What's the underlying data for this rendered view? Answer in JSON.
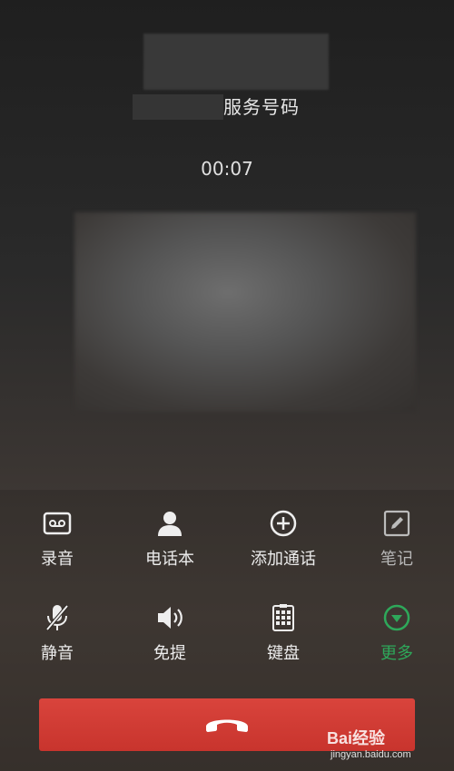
{
  "caller": {
    "number_label": "服务号码",
    "duration": "00:07"
  },
  "controls": [
    {
      "id": "record",
      "label": "录音",
      "icon": "record-icon"
    },
    {
      "id": "contacts",
      "label": "电话本",
      "icon": "contacts-icon"
    },
    {
      "id": "add-call",
      "label": "添加通话",
      "icon": "add-call-icon"
    },
    {
      "id": "notes",
      "label": "笔记",
      "icon": "notes-icon"
    },
    {
      "id": "mute",
      "label": "静音",
      "icon": "mute-icon"
    },
    {
      "id": "speaker",
      "label": "免提",
      "icon": "speaker-icon"
    },
    {
      "id": "keypad",
      "label": "键盘",
      "icon": "keypad-icon"
    },
    {
      "id": "more",
      "label": "更多",
      "icon": "chevron-down-circle-icon"
    }
  ],
  "end_call": {
    "icon": "end-call-icon"
  },
  "watermark": {
    "main": "Bai经验",
    "sub": "jingyan.baidu.com"
  },
  "colors": {
    "end_call": "#d43a33",
    "more_accent": "#2ea85a"
  }
}
